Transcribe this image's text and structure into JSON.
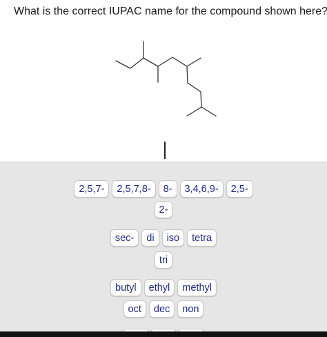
{
  "question": "What is the correct IUPAC name for the compound shown here?",
  "structure": {
    "icon": "skeletal-formula-icon"
  },
  "bank": {
    "prefix_rows": [
      [
        "2,5,7-",
        "2,5,7,8-",
        "8-",
        "3,4,6,9-",
        "2,5-"
      ],
      [
        "2-"
      ]
    ],
    "multiplier_rows": [
      [
        "sec-",
        "di",
        "iso",
        "tetra"
      ],
      [
        "tri"
      ]
    ],
    "stem_rows": [
      [
        "butyl",
        "ethyl",
        "methyl"
      ],
      [
        "oct",
        "dec",
        "non"
      ]
    ]
  }
}
